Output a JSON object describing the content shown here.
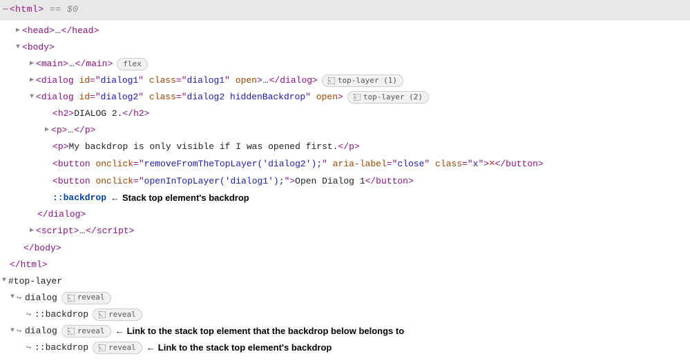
{
  "topbar": {
    "dots": "⋯",
    "tag_open": "<html>",
    "eq": " == ",
    "var": "$0"
  },
  "t": {
    "head": "head",
    "body": "body",
    "main": "main",
    "dialog": "dialog",
    "h2": "h2",
    "p": "p",
    "button": "button",
    "script": "script",
    "html": "html"
  },
  "attr": {
    "id": "id",
    "class": "class",
    "open": "open",
    "onclick": "onclick",
    "aria_label": "aria-label"
  },
  "dialog1": {
    "id": "dialog1",
    "class": "dialog1"
  },
  "dialog2": {
    "id": "dialog2",
    "class": "dialog2 hiddenBackdrop",
    "h2_text": "DIALOG 2.",
    "p_text": "My backdrop is only visible if I was opened first.",
    "btn_close_onclick": "removeFromTheTopLayer('dialog2');",
    "btn_close_aria": "close",
    "btn_close_class": "x",
    "btn_close_glyph": "✕",
    "btn_open_onclick": "openInTopLayer('dialog1');",
    "btn_open_text": "Open Dialog 1"
  },
  "badges": {
    "flex": "flex",
    "top_layer_1": "top-layer (1)",
    "top_layer_2": "top-layer (2)",
    "reveal": "reveal"
  },
  "pseudo": {
    "backdrop": "::backdrop"
  },
  "annotations": {
    "backdrop_inline": "Stack top element's backdrop",
    "dialog_link": "Link to the stack top element that the backdrop below belongs to",
    "backdrop_link": "Link to the stack top element's backdrop"
  },
  "top_layer": {
    "header": "#top-layer",
    "dialog": "dialog",
    "backdrop": "::backdrop",
    "hook": "↪"
  }
}
